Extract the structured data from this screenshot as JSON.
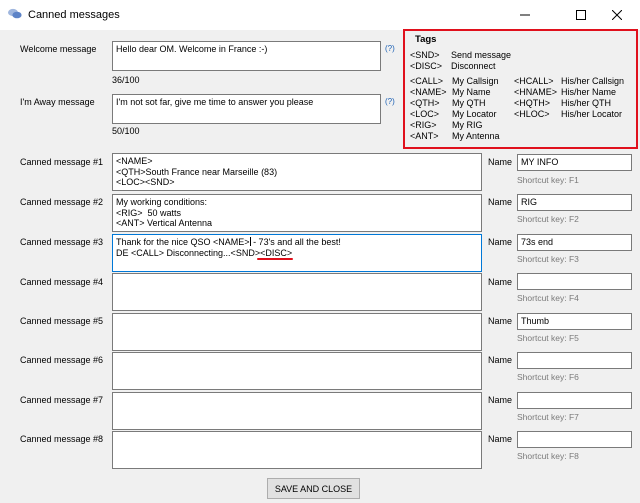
{
  "window": {
    "title": "Canned messages"
  },
  "welcome": {
    "label": "Welcome message",
    "value": "Hello dear OM. Welcome in France :-)",
    "counter": "36/100",
    "help": "(?)"
  },
  "away": {
    "label": "I'm Away message",
    "value": "I'm not sot far, give me time to answer you please",
    "counter": "50/100",
    "help": "(?)"
  },
  "tags": {
    "heading": "Tags",
    "top": [
      {
        "tag": "<SND>",
        "desc": "Send message"
      },
      {
        "tag": "<DISC>",
        "desc": "Disconnect"
      }
    ],
    "left": [
      {
        "tag": "<CALL>",
        "desc": "My Callsign"
      },
      {
        "tag": "<NAME>",
        "desc": "My Name"
      },
      {
        "tag": "<QTH>",
        "desc": "My QTH"
      },
      {
        "tag": "<LOC>",
        "desc": "My Locator"
      },
      {
        "tag": "<RIG>",
        "desc": "My RIG"
      },
      {
        "tag": "<ANT>",
        "desc": "My Antenna"
      }
    ],
    "right": [
      {
        "tag": "<HCALL>",
        "desc": "His/her Callsign"
      },
      {
        "tag": "<HNAME>",
        "desc": "His/her Name"
      },
      {
        "tag": "<HQTH>",
        "desc": "His/her QTH"
      },
      {
        "tag": "<HLOC>",
        "desc": "His/her Locator"
      }
    ]
  },
  "canned": [
    {
      "label": "Canned message #1",
      "text": "<NAME>\n<QTH>South France near Marseille (83)\n<LOC><SND>",
      "name_label": "Name",
      "name": "MY INFO",
      "shortcut": "Shortcut key: F1"
    },
    {
      "label": "Canned message #2",
      "text": "My working conditions:\n<RIG>  50 watts\n<ANT> Vertical Antenna",
      "name_label": "Name",
      "name": "RIG",
      "shortcut": "Shortcut key: F2"
    },
    {
      "label": "Canned message #3",
      "text_a": "Thank for the nice QSO <NAME>",
      "text_b": " - 73's and all the best!",
      "text_c": "DE <CALL> Disconnecting...<SND><DISC>",
      "name_label": "Name",
      "name": "73s end",
      "shortcut": "Shortcut key: F3"
    },
    {
      "label": "Canned message #4",
      "text": "",
      "name_label": "Name",
      "name": "",
      "shortcut": "Shortcut key: F4"
    },
    {
      "label": "Canned message #5",
      "text": "",
      "name_label": "Name",
      "name": "Thumb",
      "shortcut": "Shortcut key: F5"
    },
    {
      "label": "Canned message #6",
      "text": "",
      "name_label": "Name",
      "name": "",
      "shortcut": "Shortcut key: F6"
    },
    {
      "label": "Canned message #7",
      "text": "",
      "name_label": "Name",
      "name": "",
      "shortcut": "Shortcut key: F7"
    },
    {
      "label": "Canned message #8",
      "text": "",
      "name_label": "Name",
      "name": "",
      "shortcut": "Shortcut key: F8"
    }
  ],
  "save_button": "SAVE AND CLOSE"
}
